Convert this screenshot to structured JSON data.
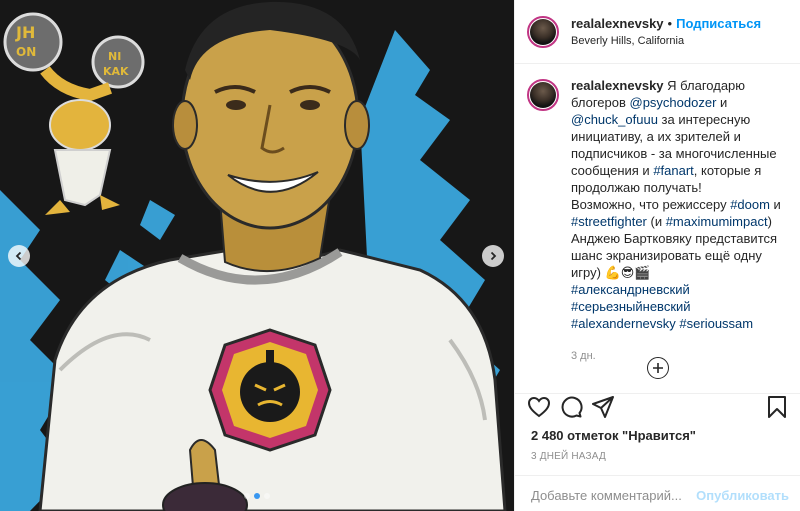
{
  "post": {
    "username": "realalexnevsky",
    "separator": "•",
    "follow_label": "Подписаться",
    "location": "Beverly Hills, California"
  },
  "media": {
    "carousel_total": 3,
    "carousel_active": 2,
    "art_text": {
      "ball_left_top": "JH",
      "ball_left_bottom": "ON",
      "ball_right_top": "NI",
      "ball_right_bottom": "KAK"
    },
    "colors": {
      "background": "#161616",
      "splash": "#3aa6dd",
      "shirt": "#f2f2ee",
      "skin": "#c9a14a"
    }
  },
  "caption": {
    "username": "realalexnevsky",
    "lines": [
      [
        {
          "t": "Я благодарю",
          "k": "text"
        }
      ],
      [
        {
          "t": "блогеров ",
          "k": "text"
        },
        {
          "t": "@psychodozer",
          "k": "link"
        },
        {
          "t": " и",
          "k": "text"
        }
      ],
      [
        {
          "t": "@chuck_ofuuu",
          "k": "link"
        },
        {
          "t": " за интересную",
          "k": "text"
        }
      ],
      [
        {
          "t": "инициативу, а их зрителей и",
          "k": "text"
        }
      ],
      [
        {
          "t": "подписчиков - за многочисленные",
          "k": "text"
        }
      ],
      [
        {
          "t": "сообщения и ",
          "k": "text"
        },
        {
          "t": "#fanart",
          "k": "link"
        },
        {
          "t": ", которые я",
          "k": "text"
        }
      ],
      [
        {
          "t": "продолжаю получать!",
          "k": "text"
        }
      ],
      [
        {
          "t": "Возможно, что режиссеру ",
          "k": "text"
        },
        {
          "t": "#doom",
          "k": "link"
        },
        {
          "t": " и",
          "k": "text"
        }
      ],
      [
        {
          "t": "#streetfighter",
          "k": "link"
        },
        {
          "t": " (и ",
          "k": "text"
        },
        {
          "t": "#maximumimpact",
          "k": "link"
        },
        {
          "t": ")",
          "k": "text"
        }
      ],
      [
        {
          "t": "Анджею Бартковяку представится",
          "k": "text"
        }
      ],
      [
        {
          "t": "шанс экранизировать ещё одну",
          "k": "text"
        }
      ],
      [
        {
          "t": "игру) 💪😎🎬",
          "k": "text"
        }
      ],
      [
        {
          "t": "#александрневский",
          "k": "link"
        }
      ],
      [
        {
          "t": "#серьезныйневский",
          "k": "link"
        }
      ],
      [
        {
          "t": "#alexandernevsky",
          "k": "link"
        },
        {
          "t": " ",
          "k": "text"
        },
        {
          "t": "#serioussam",
          "k": "link"
        }
      ]
    ],
    "time": "3 дн."
  },
  "actions": {
    "likes": "2 480 отметок \"Нравится\"",
    "posted": "3 ДНЕЙ НАЗАД"
  },
  "comment_box": {
    "placeholder": "Добавьте комментарий...",
    "publish_label": "Опубликовать"
  },
  "icons": [
    "heart-icon",
    "comment-icon",
    "share-icon",
    "bookmark-icon",
    "chevron-left-icon",
    "chevron-right-icon",
    "plus-circle-icon"
  ]
}
